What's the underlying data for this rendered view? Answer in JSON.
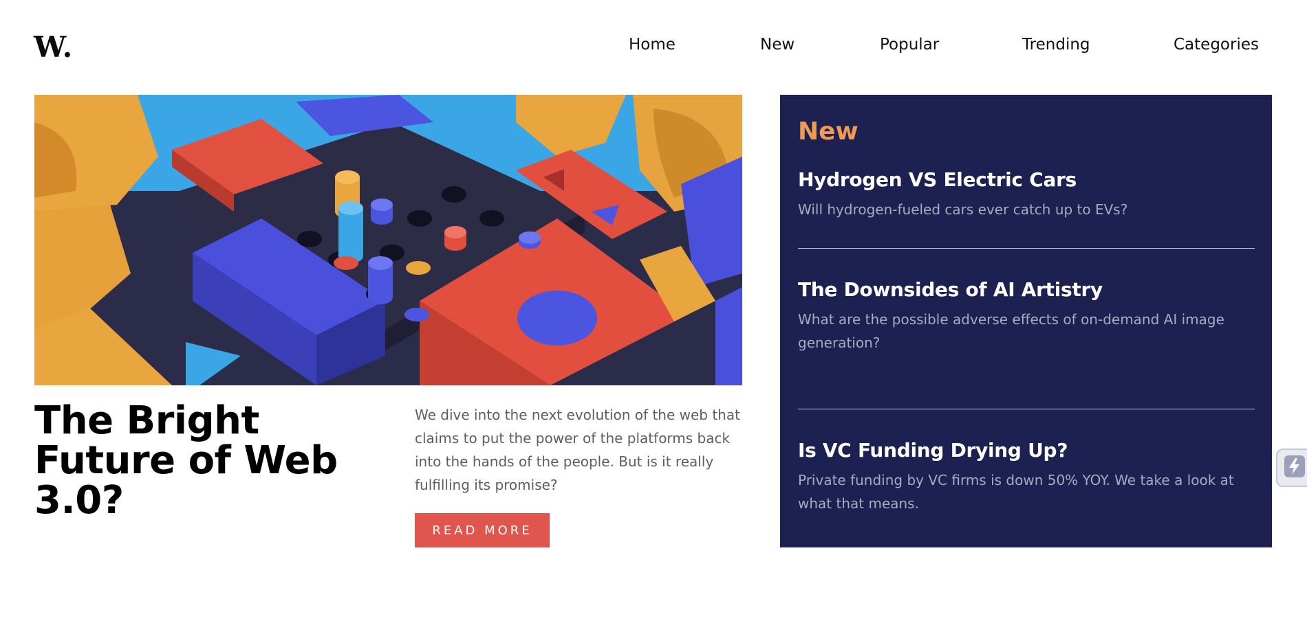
{
  "header": {
    "logo": "W.",
    "nav": [
      "Home",
      "New",
      "Popular",
      "Trending",
      "Categories"
    ]
  },
  "hero": {
    "image_alt": "3D colorful blocks illustration",
    "title": "The Bright Future of Web 3.0?",
    "description": "We dive into the next evolution of the web that claims to put the power of the platforms back into the hands of the people. But is it really fulfilling its promise?",
    "button_label": "READ MORE"
  },
  "sidebar": {
    "title": "New",
    "items": [
      {
        "title": "Hydrogen VS Electric Cars",
        "description": "Will hydrogen-fueled cars ever catch up to EVs?"
      },
      {
        "title": "The Downsides of AI Artistry",
        "description": "What are the possible adverse effects of on-demand AI image generation?"
      },
      {
        "title": "Is VC Funding Drying Up?",
        "description": "Private funding by VC firms is down 50% YOY. We take a look at what that means."
      }
    ]
  },
  "colors": {
    "accent_button": "#e0554d",
    "sidebar_bg": "#1d2152",
    "sidebar_title": "#ef9a52",
    "muted_text": "#a8abbd"
  },
  "icons": {
    "floating_widget": "lightning-icon"
  }
}
